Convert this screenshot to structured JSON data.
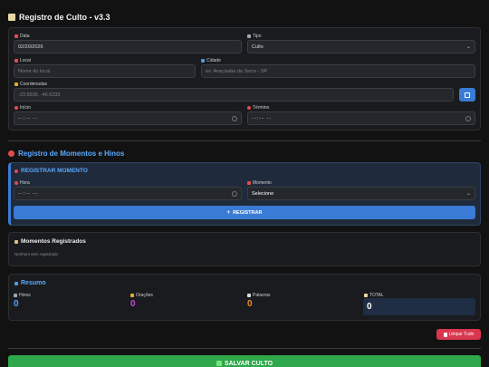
{
  "header": {
    "title": "Registro de Culto - v3.3"
  },
  "form": {
    "date": {
      "label": "Data",
      "value": "02/20/2026"
    },
    "type": {
      "label": "Tipo",
      "value": "Culto"
    },
    "location": {
      "label": "Local",
      "placeholder": "Nome do local"
    },
    "city": {
      "label": "Cidade",
      "placeholder": "ex: Araçoiaba da Serra - SP"
    },
    "coords": {
      "label": "Coordenadas",
      "placeholder": "-23.5505, -46.6333"
    },
    "start": {
      "label": "Início",
      "value": "--:-- --"
    },
    "end": {
      "label": "Término",
      "value": "--:-- --"
    }
  },
  "moments_section": {
    "title": "Registro de Momentos e Hinos"
  },
  "register_moment": {
    "title": "REGISTRAR MOMENTO",
    "hour": {
      "label": "Hora",
      "value": "--:-- --"
    },
    "moment": {
      "label": "Momento",
      "value": "Selecione"
    },
    "button": "REGISTRAR"
  },
  "registered": {
    "title": "Momentos Registrados",
    "empty_text": "Nenhum item registrado"
  },
  "summary": {
    "title": "Resumo",
    "hinos": {
      "label": "Hinos",
      "value": "0",
      "color": "#4da3ff"
    },
    "oracoes": {
      "label": "Orações",
      "value": "0",
      "color": "#c14ad6"
    },
    "palavras": {
      "label": "Palavras",
      "value": "0",
      "color": "#f08a24"
    },
    "total": {
      "label": "TOTAL",
      "value": "0"
    }
  },
  "actions": {
    "clear": "Limpar Tudo",
    "save": "SALVAR CULTO"
  }
}
